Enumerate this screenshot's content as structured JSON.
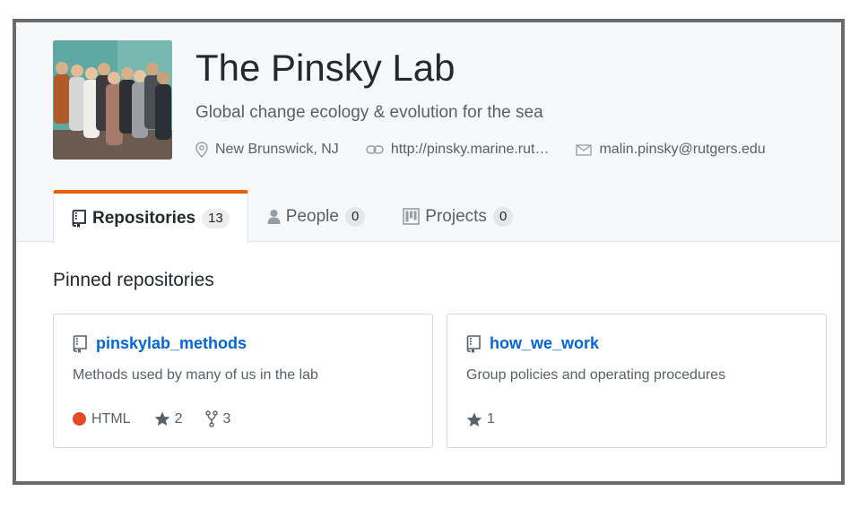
{
  "org": {
    "name": "The Pinsky Lab",
    "description": "Global change ecology & evolution for the sea",
    "location": "New Brunswick, NJ",
    "website": "http://pinsky.marine.rut…",
    "email": "malin.pinsky@rutgers.edu"
  },
  "tabs": [
    {
      "label": "Repositories",
      "count": "13",
      "selected": true,
      "icon": "repo-icon"
    },
    {
      "label": "People",
      "count": "0",
      "selected": false,
      "icon": "person-icon"
    },
    {
      "label": "Projects",
      "count": "0",
      "selected": false,
      "icon": "project-icon"
    }
  ],
  "pinned": {
    "title": "Pinned repositories",
    "repos": [
      {
        "name": "pinskylab_methods",
        "description": "Methods used by many of us in the lab",
        "language": "HTML",
        "language_color": "#e34c26",
        "stars": "2",
        "forks": "3"
      },
      {
        "name": "how_we_work",
        "description": "Group policies and operating procedures",
        "stars": "1"
      }
    ]
  },
  "colors": {
    "accent": "#e36209",
    "link": "#0366d6",
    "muted": "#586069"
  }
}
